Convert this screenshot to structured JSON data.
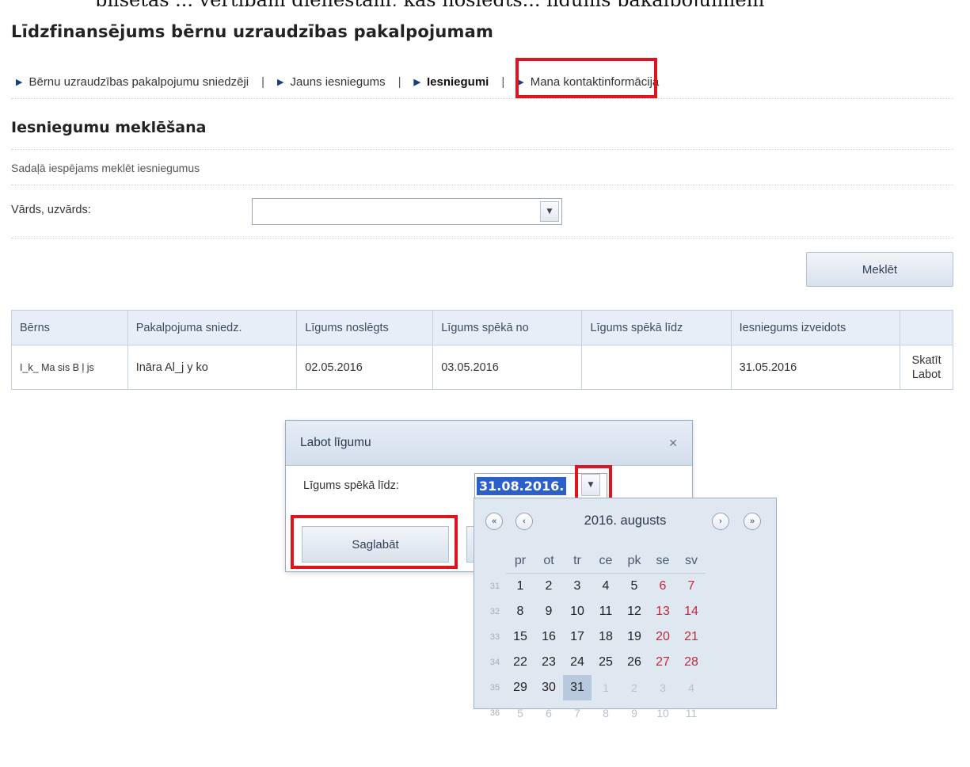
{
  "page": {
    "cropped_top_text": "pilsētas ... vērtībām dienestam, kas noslēgts... līgums pakalpojumiem",
    "title": "Līdzfinansējums bērnu uzraudzības pakalpojumam"
  },
  "nav": {
    "items": [
      {
        "label": "Bērnu uzraudzības pakalpojumu sniedzēji",
        "active": false
      },
      {
        "label": "Jauns iesniegums",
        "active": false
      },
      {
        "label": "Iesniegumi",
        "active": true
      },
      {
        "label": "Mana kontaktinformācija",
        "active": false
      }
    ],
    "separator": "|"
  },
  "search": {
    "section_title": "Iesniegumu meklēšana",
    "description": "Sadaļā iespējams meklēt iesniegumus",
    "name_label": "Vārds, uzvārds:",
    "name_value": "",
    "search_button": "Meklēt"
  },
  "table": {
    "headers": [
      "Bērns",
      "Pakalpojuma sniedz.",
      "Līgums noslēgts",
      "Līgums spēkā no",
      "Līgums spēkā līdz",
      "Iesniegums izveidots",
      ""
    ],
    "rows": [
      {
        "child": "I_k_ Ma  sis B  ļ  js",
        "provider": "Ināra Al_j  y  ko",
        "concluded": "02.05.2016",
        "valid_from": "03.05.2016",
        "valid_to": "",
        "created": "31.05.2016",
        "view_action": "Skatīt",
        "edit_action": "Labot"
      }
    ]
  },
  "dialog": {
    "title": "Labot līgumu",
    "field_label": "Līgums spēkā līdz:",
    "date_value": "31.08.2016.",
    "save_button": "Saglabāt"
  },
  "calendar": {
    "title": "2016. augusts",
    "weekdays": [
      "pr",
      "ot",
      "tr",
      "ce",
      "pk",
      "se",
      "sv"
    ],
    "weeks": [
      {
        "week": "31",
        "days": [
          "1",
          "2",
          "3",
          "4",
          "5",
          "6",
          "7"
        ]
      },
      {
        "week": "32",
        "days": [
          "8",
          "9",
          "10",
          "11",
          "12",
          "13",
          "14"
        ]
      },
      {
        "week": "33",
        "days": [
          "15",
          "16",
          "17",
          "18",
          "19",
          "20",
          "21"
        ]
      },
      {
        "week": "34",
        "days": [
          "22",
          "23",
          "24",
          "25",
          "26",
          "27",
          "28"
        ]
      },
      {
        "week": "35",
        "days": [
          "29",
          "30",
          "31",
          "1",
          "2",
          "3",
          "4"
        ]
      },
      {
        "week": "36",
        "days": [
          "5",
          "6",
          "7",
          "8",
          "9",
          "10",
          "11"
        ]
      }
    ],
    "selected_day": "31"
  },
  "colors": {
    "highlight_red": "#e0141e",
    "selection_blue": "#2a5fcc",
    "weekend_red": "#c5273a"
  }
}
